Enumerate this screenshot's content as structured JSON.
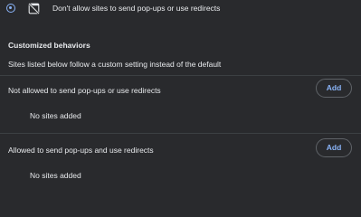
{
  "popup_option": {
    "label": "Don't allow sites to send pop-ups or use redirects",
    "selected": true,
    "icon": "popup-blocked-icon"
  },
  "customized": {
    "heading": "Customized behaviors",
    "description": "Sites listed below follow a custom setting instead of the default"
  },
  "not_allowed": {
    "label": "Not allowed to send pop-ups or use redirects",
    "add_label": "Add",
    "empty_text": "No sites added"
  },
  "allowed": {
    "label": "Allowed to send pop-ups and use redirects",
    "add_label": "Add",
    "empty_text": "No sites added"
  },
  "colors": {
    "background": "#292a2d",
    "text": "#e8eaed",
    "accent": "#8ab4f8",
    "border": "#5f6368"
  }
}
